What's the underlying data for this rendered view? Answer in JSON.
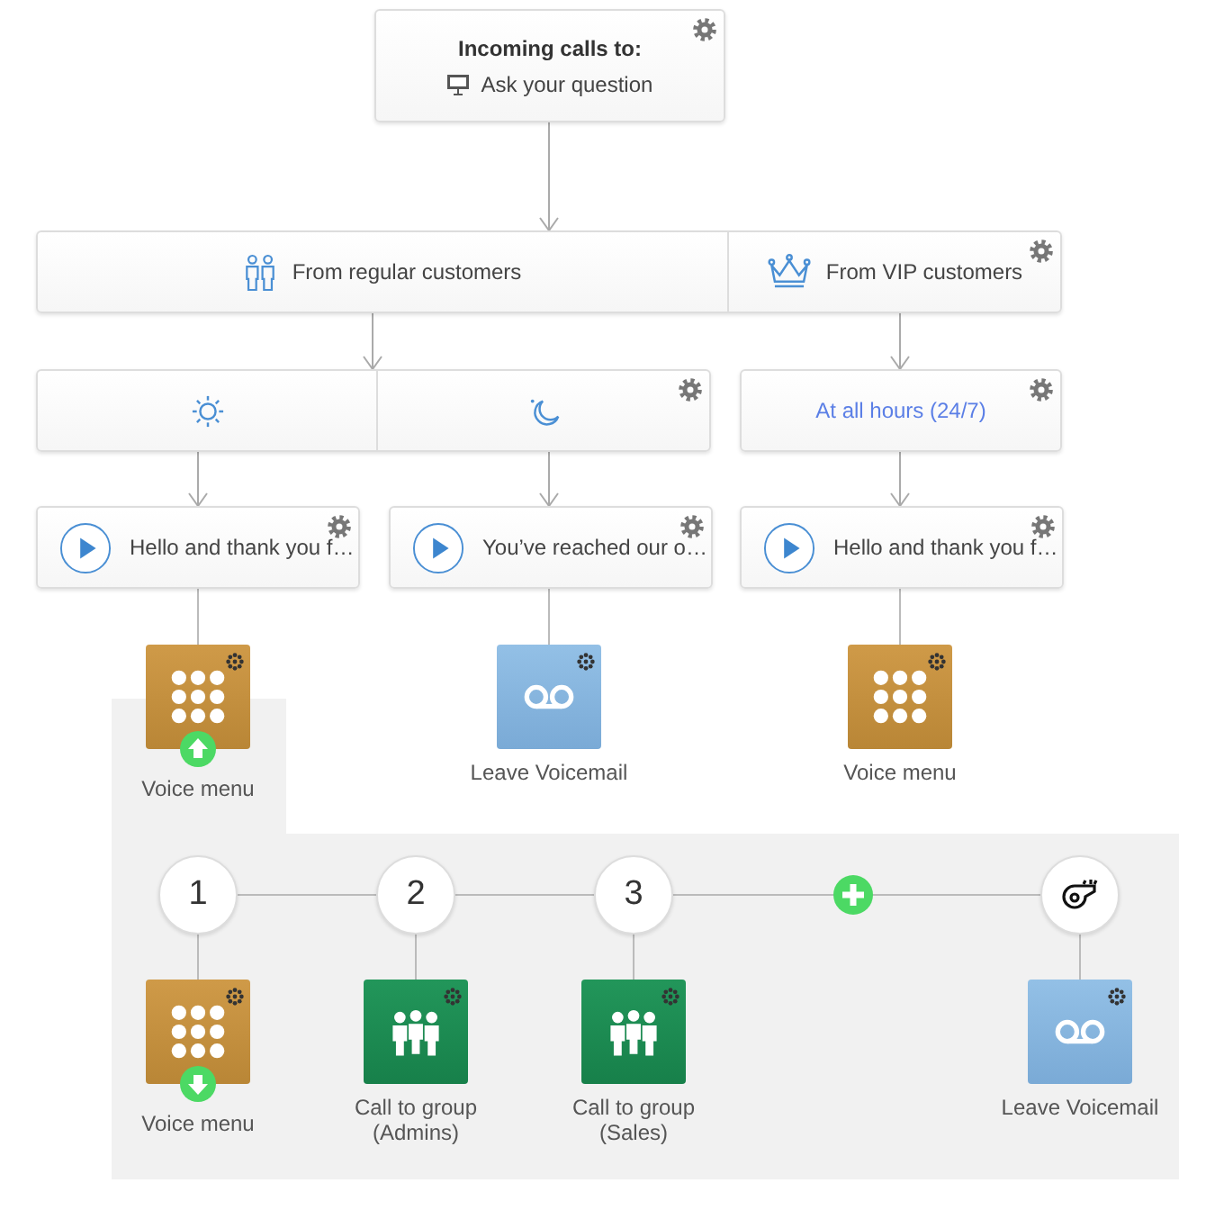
{
  "entry": {
    "title": "Incoming calls to:",
    "target": "Ask your question"
  },
  "branches": [
    {
      "label": "From regular customers",
      "kind": "people",
      "schedules": [
        {
          "kind": "day"
        },
        {
          "kind": "night"
        }
      ]
    },
    {
      "label": "From VIP customers",
      "kind": "vip",
      "schedules": [
        {
          "kind": "always",
          "label": "At all hours (24/7)"
        }
      ]
    }
  ],
  "greetings": [
    {
      "text": "Hello and thank you f…",
      "action": {
        "kind": "voice_menu",
        "label": "Voice menu",
        "expanded": true
      }
    },
    {
      "text": "You’ve reached our o…",
      "action": {
        "kind": "voicemail",
        "label": "Leave Voicemail"
      }
    },
    {
      "text": "Hello and thank you f…",
      "action": {
        "kind": "voice_menu",
        "label": "Voice menu"
      }
    }
  ],
  "voice_menu": {
    "add_option": true,
    "options": [
      {
        "kind": "key",
        "key": "1",
        "action": {
          "kind": "voice_menu",
          "label": "Voice menu",
          "expanded": false
        }
      },
      {
        "kind": "key",
        "key": "2",
        "action": {
          "kind": "group",
          "label": "Call to group",
          "detail": "(Admins)"
        }
      },
      {
        "kind": "key",
        "key": "3",
        "action": {
          "kind": "group",
          "label": "Call to group",
          "detail": "(Sales)"
        }
      },
      {
        "kind": "fallback",
        "action": {
          "kind": "voicemail",
          "label": "Leave Voicemail"
        }
      }
    ]
  }
}
